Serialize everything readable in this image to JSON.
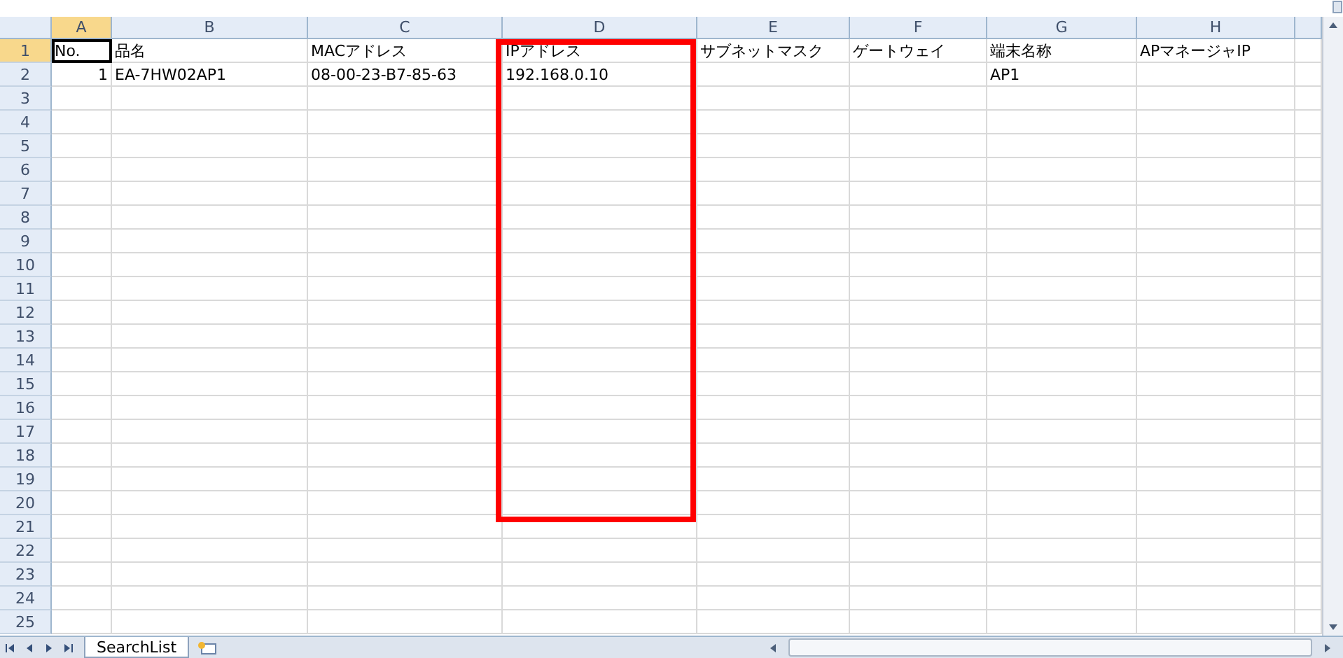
{
  "columns": [
    {
      "label": "A",
      "selected": true
    },
    {
      "label": "B",
      "selected": false
    },
    {
      "label": "C",
      "selected": false
    },
    {
      "label": "D",
      "selected": false
    },
    {
      "label": "E",
      "selected": false
    },
    {
      "label": "F",
      "selected": false
    },
    {
      "label": "G",
      "selected": false
    },
    {
      "label": "H",
      "selected": false
    }
  ],
  "rows": [
    {
      "number": "1",
      "selected": true,
      "cells": [
        {
          "text": "No.",
          "kind": "text",
          "active": true
        },
        {
          "text": "品名",
          "kind": "text",
          "active": false
        },
        {
          "text": "MACアドレス",
          "kind": "text",
          "active": false
        },
        {
          "text": "IPアドレス",
          "kind": "text",
          "active": false
        },
        {
          "text": "サブネットマスク",
          "kind": "text",
          "active": false
        },
        {
          "text": "ゲートウェイ",
          "kind": "text",
          "active": false
        },
        {
          "text": "端末名称",
          "kind": "text",
          "active": false
        },
        {
          "text": "APマネージャIP",
          "kind": "text",
          "active": false
        }
      ]
    },
    {
      "number": "2",
      "selected": false,
      "cells": [
        {
          "text": "1",
          "kind": "number",
          "active": false
        },
        {
          "text": "EA-7HW02AP1",
          "kind": "text",
          "active": false
        },
        {
          "text": "08-00-23-B7-85-63",
          "kind": "text",
          "active": false
        },
        {
          "text": "192.168.0.10",
          "kind": "text",
          "active": false
        },
        null,
        null,
        {
          "text": "AP1",
          "kind": "text",
          "active": false
        },
        null
      ]
    },
    {
      "number": "3",
      "selected": false
    },
    {
      "number": "4",
      "selected": false
    },
    {
      "number": "5",
      "selected": false
    },
    {
      "number": "6",
      "selected": false
    },
    {
      "number": "7",
      "selected": false
    },
    {
      "number": "8",
      "selected": false
    },
    {
      "number": "9",
      "selected": false
    },
    {
      "number": "10",
      "selected": false
    },
    {
      "number": "11",
      "selected": false
    },
    {
      "number": "12",
      "selected": false
    },
    {
      "number": "13",
      "selected": false
    },
    {
      "number": "14",
      "selected": false
    },
    {
      "number": "15",
      "selected": false
    },
    {
      "number": "16",
      "selected": false
    },
    {
      "number": "17",
      "selected": false
    },
    {
      "number": "18",
      "selected": false
    },
    {
      "number": "19",
      "selected": false
    },
    {
      "number": "20",
      "selected": false
    },
    {
      "number": "21",
      "selected": false
    },
    {
      "number": "22",
      "selected": false
    },
    {
      "number": "23",
      "selected": false
    },
    {
      "number": "24",
      "selected": false
    },
    {
      "number": "25",
      "selected": false
    }
  ],
  "annotation": {
    "kind": "rectangle",
    "color": "#ff0000"
  },
  "sheet_tabs": [
    {
      "label": "SearchList",
      "selected": true
    }
  ]
}
